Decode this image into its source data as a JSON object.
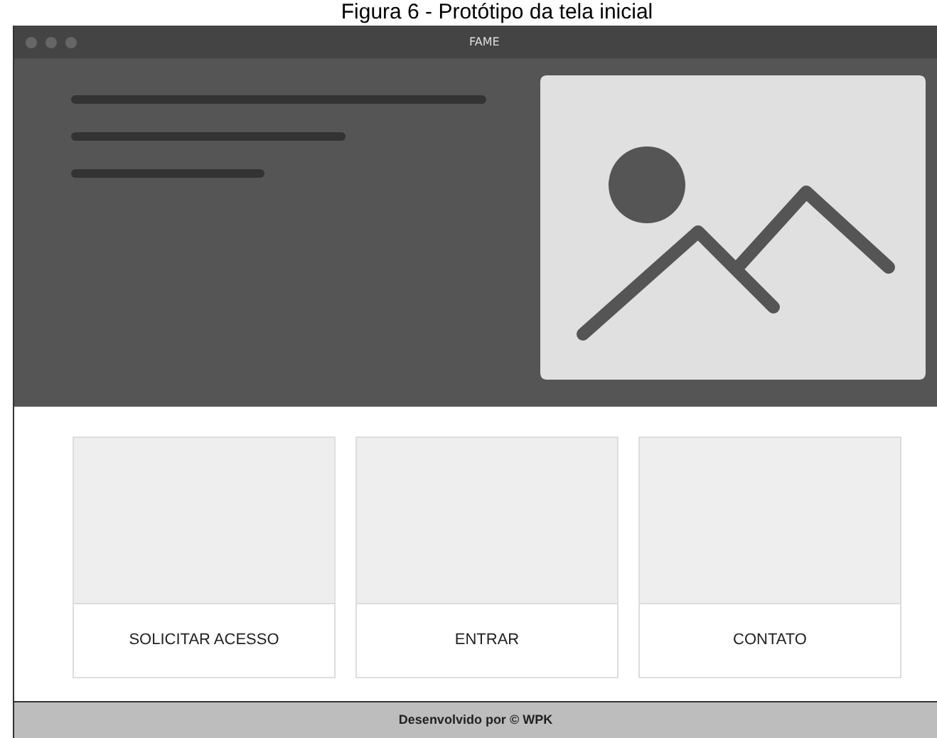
{
  "caption": "Figura 6 - Protótipo da tela inicial",
  "window": {
    "title": "FAME"
  },
  "cards": [
    {
      "label": "SOLICITAR ACESSO"
    },
    {
      "label": "ENTRAR"
    },
    {
      "label": "CONTATO"
    }
  ],
  "footer": "Desenvolvido por © WPK"
}
